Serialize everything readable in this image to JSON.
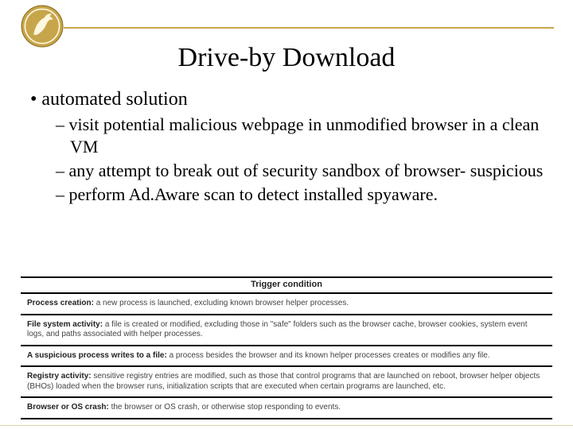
{
  "title": "Drive-by Download",
  "bullet1": "automated solution",
  "sub1": "visit potential malicious webpage in unmodified browser in a clean VM",
  "sub2": "any attempt to break out of security sandbox of browser- suspicious",
  "sub3": "perform Ad.Aware scan to detect installed spyaware.",
  "trigger_header": "Trigger condition",
  "rows": [
    {
      "label": "Process creation:",
      "text": " a new process is launched, excluding known browser helper processes."
    },
    {
      "label": "File system activity:",
      "text": " a file is created or modified, excluding those in \"safe\" folders such as the browser cache, browser cookies, system event logs, and paths associated with helper processes."
    },
    {
      "label": "A suspicious process writes to a file:",
      "text": " a process besides the browser and its known helper processes creates or modifies any file."
    },
    {
      "label": "Registry activity:",
      "text": " sensitive registry entries are modified, such as those that control programs that are launched on reboot, browser helper objects (BHOs) loaded when the browser runs, initialization scripts that are executed when certain programs are launched, etc."
    },
    {
      "label": "Browser or OS crash:",
      "text": " the browser or OS crash, or otherwise stop responding to events."
    }
  ]
}
